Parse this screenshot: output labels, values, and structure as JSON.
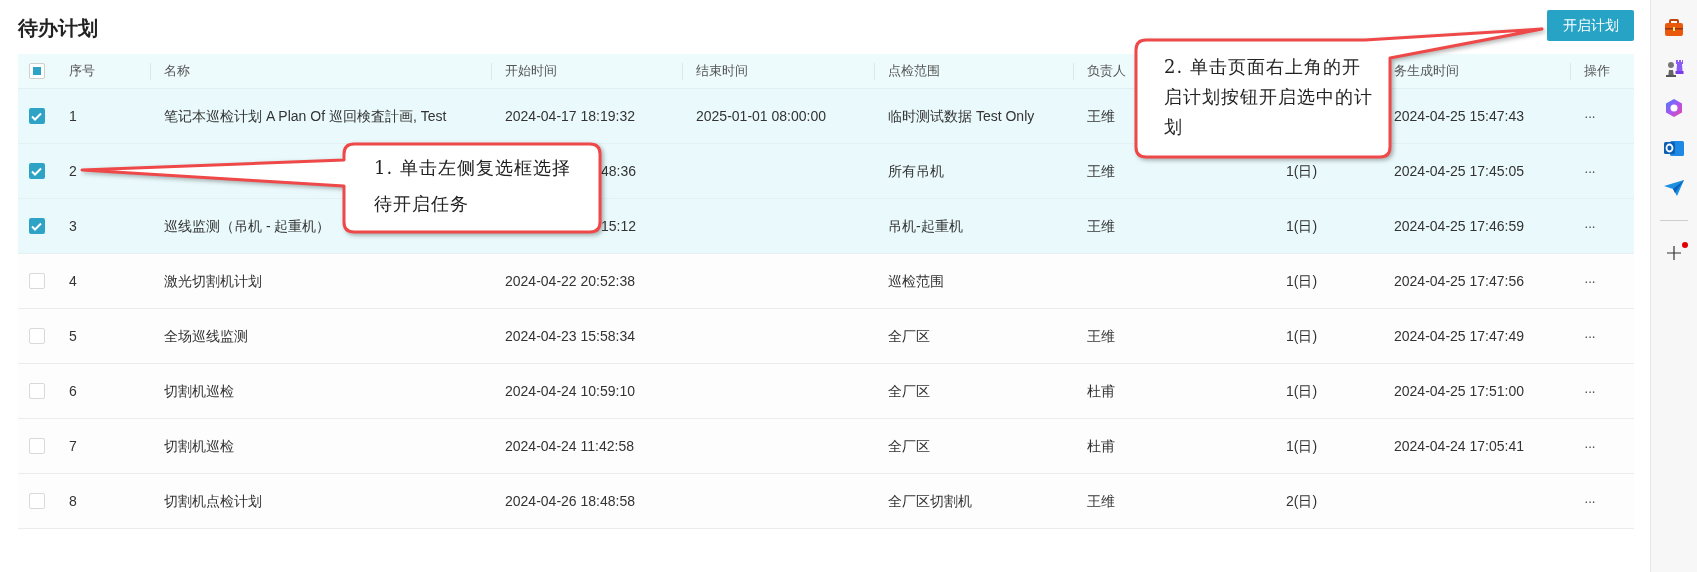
{
  "title": "待办计划",
  "primary_button": "开启计划",
  "table": {
    "select_all": {
      "indeterminate": true
    },
    "columns": [
      {
        "label": "序号"
      },
      {
        "label": "名称"
      },
      {
        "label": "开始时间"
      },
      {
        "label": "结束时间"
      },
      {
        "label": "点检范围"
      },
      {
        "label": "负责人"
      },
      {},
      {
        "label": "务生成时间"
      },
      {
        "label": "操作"
      }
    ],
    "rows": [
      {
        "checked": true,
        "no": "1",
        "name": "笔记本巡检计划 A Plan Of 巡回検査計画, Test",
        "start": "2024-04-17 18:19:32",
        "end": "2025-01-01 08:00:00",
        "scope": "临时测试数据 Test Only",
        "owner": "王维",
        "generated": "2024-04-25 15:47:43",
        "action": "···"
      },
      {
        "checked": true,
        "no": "2",
        "start": "48:36",
        "start_clipped": true,
        "scope": "所有吊机",
        "owner": "王维",
        "cycle": "1(日)",
        "generated": "2024-04-25 17:45:05",
        "action": "···"
      },
      {
        "checked": true,
        "no": "3",
        "name": "巡线监测（吊机 - 起重机）",
        "start": "15:12",
        "start_clipped": true,
        "scope": "吊机-起重机",
        "owner": "王维",
        "cycle": "1(日)",
        "generated": "2024-04-25 17:46:59",
        "action": "···"
      },
      {
        "checked": false,
        "no": "4",
        "name": "激光切割机计划",
        "start": "2024-04-22 20:52:38",
        "scope": "巡检范围",
        "cycle": "1(日)",
        "generated": "2024-04-25 17:47:56",
        "action": "···"
      },
      {
        "checked": false,
        "no": "5",
        "name": "全场巡线监测",
        "start": "2024-04-23 15:58:34",
        "scope": "全厂区",
        "owner": "王维",
        "cycle": "1(日)",
        "generated": "2024-04-25 17:47:49",
        "action": "···"
      },
      {
        "checked": false,
        "no": "6",
        "name": "切割机巡检",
        "start": "2024-04-24 10:59:10",
        "scope": "全厂区",
        "owner": "杜甫",
        "cycle": "1(日)",
        "generated": "2024-04-25 17:51:00",
        "action": "···"
      },
      {
        "checked": false,
        "no": "7",
        "name": "切割机巡检",
        "start": "2024-04-24 11:42:58",
        "scope": "全厂区",
        "owner": "杜甫",
        "cycle": "1(日)",
        "generated": "2024-04-24 17:05:41",
        "action": "···"
      },
      {
        "checked": false,
        "no": "8",
        "name": "切割机点检计划",
        "start": "2024-04-26 18:48:58",
        "scope": "全厂区切割机",
        "owner": "王维",
        "cycle": "2(日)",
        "action": "···"
      }
    ]
  },
  "annotations": [
    {
      "text": "1. 单击左侧复选框选择待开启任务"
    },
    {
      "text": "2. 单击页面右上角的开启计划按钮开启选中的计划"
    }
  ],
  "sidebar": {
    "items": [
      {
        "kind": "toolbox"
      },
      {
        "kind": "chess"
      },
      {
        "kind": "copilot"
      },
      {
        "kind": "outlook"
      },
      {
        "kind": "send"
      },
      {
        "kind": "divider"
      },
      {
        "kind": "add",
        "has_notification": true
      }
    ]
  }
}
